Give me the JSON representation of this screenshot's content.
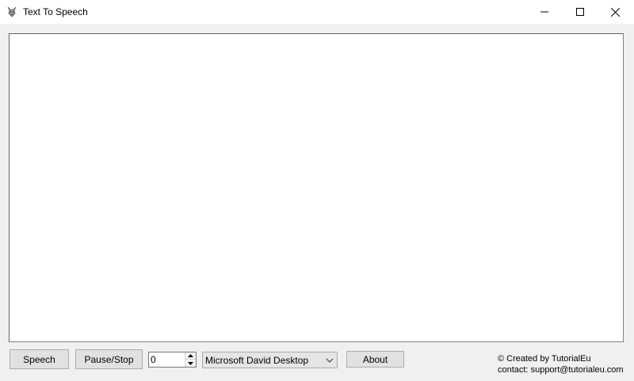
{
  "window": {
    "title": "Text To Speech",
    "icon": "wolf-icon",
    "controls": {
      "minimize": "minimize-icon",
      "maximize": "maximize-icon",
      "close": "close-icon"
    }
  },
  "editor": {
    "text": ""
  },
  "toolbar": {
    "speech_label": "Speech",
    "pause_stop_label": "Pause/Stop",
    "rate_value": "0",
    "voice_selected": "Microsoft David Desktop",
    "about_label": "About"
  },
  "credits": {
    "line1": "© Created by TutorialEu",
    "line2": "contact: support@tutorialeu.com"
  }
}
